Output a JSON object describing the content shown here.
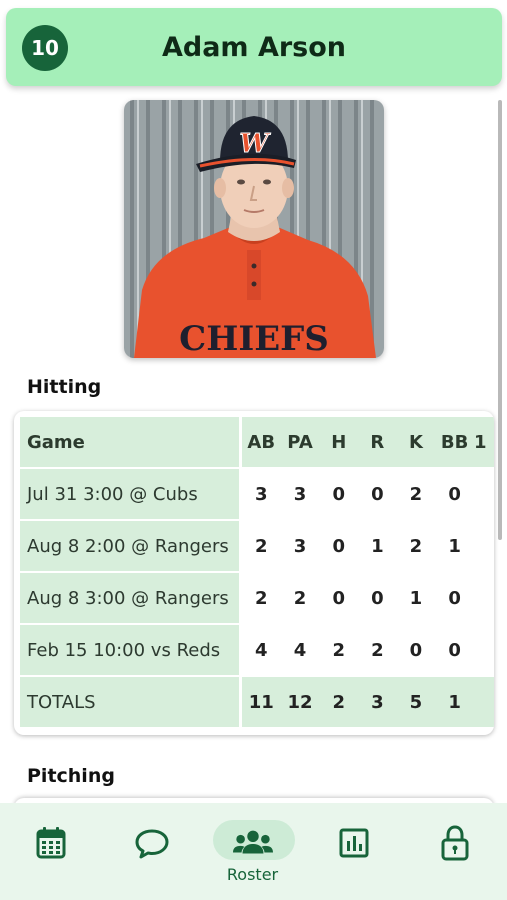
{
  "header": {
    "jersey_number": "10",
    "player_name": "Adam Arson"
  },
  "photo": {
    "shirt_lettering": "CHIEFS"
  },
  "hitting": {
    "section_title": "Hitting",
    "columns": [
      "Game",
      "AB",
      "PA",
      "H",
      "R",
      "K",
      "BB",
      "1"
    ],
    "rows": [
      {
        "game": "Jul 31 3:00 @ Cubs",
        "stats": [
          "3",
          "3",
          "0",
          "0",
          "2",
          "0"
        ]
      },
      {
        "game": "Aug 8 2:00 @ Rangers",
        "stats": [
          "2",
          "3",
          "0",
          "1",
          "2",
          "1"
        ]
      },
      {
        "game": "Aug 8 3:00 @ Rangers",
        "stats": [
          "2",
          "2",
          "0",
          "0",
          "1",
          "0"
        ]
      },
      {
        "game": "Feb 15 10:00 vs Reds",
        "stats": [
          "4",
          "4",
          "2",
          "2",
          "0",
          "0"
        ]
      }
    ],
    "totals": {
      "label": "TOTALS",
      "stats": [
        "11",
        "12",
        "2",
        "3",
        "5",
        "1"
      ]
    }
  },
  "pitching": {
    "section_title": "Pitching"
  },
  "bottom_nav": {
    "items": [
      {
        "icon": "calendar-icon",
        "label": ""
      },
      {
        "icon": "chat-icon",
        "label": ""
      },
      {
        "icon": "people-icon",
        "label": "Roster",
        "active": true
      },
      {
        "icon": "bar-chart-icon",
        "label": ""
      },
      {
        "icon": "lock-icon",
        "label": ""
      }
    ]
  },
  "colors": {
    "header_bg": "#a5efb9",
    "accent": "#17643a",
    "table_header_bg": "#d7eedb",
    "nav_bg": "#e9f6ec"
  }
}
